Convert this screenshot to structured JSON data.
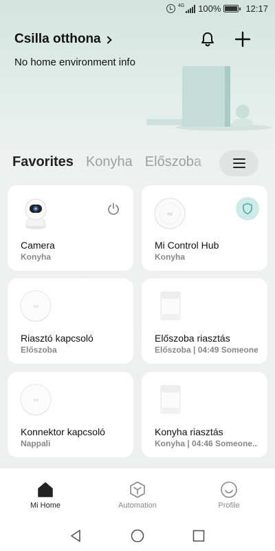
{
  "status_bar": {
    "network": "4G",
    "battery": "100%",
    "time": "12:17"
  },
  "header": {
    "home_name": "Csilla otthona",
    "env_info": "No home environment info",
    "icons": [
      "bell-icon",
      "plus-icon"
    ]
  },
  "tabs": [
    {
      "label": "Favorites",
      "active": true
    },
    {
      "label": "Konyha",
      "active": false
    },
    {
      "label": "Előszoba",
      "active": false
    }
  ],
  "devices": [
    {
      "name": "Camera",
      "room": "Konyha",
      "icon": "camera-icon",
      "action": "power-icon"
    },
    {
      "name": "Mi Control Hub",
      "room": "Konyha",
      "icon": "hub-icon",
      "action": "shield-icon"
    },
    {
      "name": "Riasztó kapcsoló",
      "room": "Előszoba",
      "icon": "wireless-switch-icon"
    },
    {
      "name": "Előszoba riasztás",
      "room": "Előszoba | 04:49 Someone...",
      "icon": "motion-sensor-icon"
    },
    {
      "name": "Konnektor kapcsoló",
      "room": "Nappali",
      "icon": "wireless-switch-icon"
    },
    {
      "name": "Konyha riasztás",
      "room": "Konyha | 04:46 Someone...",
      "icon": "motion-sensor-icon"
    }
  ],
  "bottom_nav": [
    {
      "label": "Mi Home",
      "icon": "home-icon",
      "active": true
    },
    {
      "label": "Automation",
      "icon": "hexagon-icon",
      "active": false
    },
    {
      "label": "Profile",
      "icon": "smile-icon",
      "active": false
    }
  ],
  "colors": {
    "accent_teal": "#5dbfb8",
    "background": "#eef0f0",
    "card": "#ffffff"
  }
}
